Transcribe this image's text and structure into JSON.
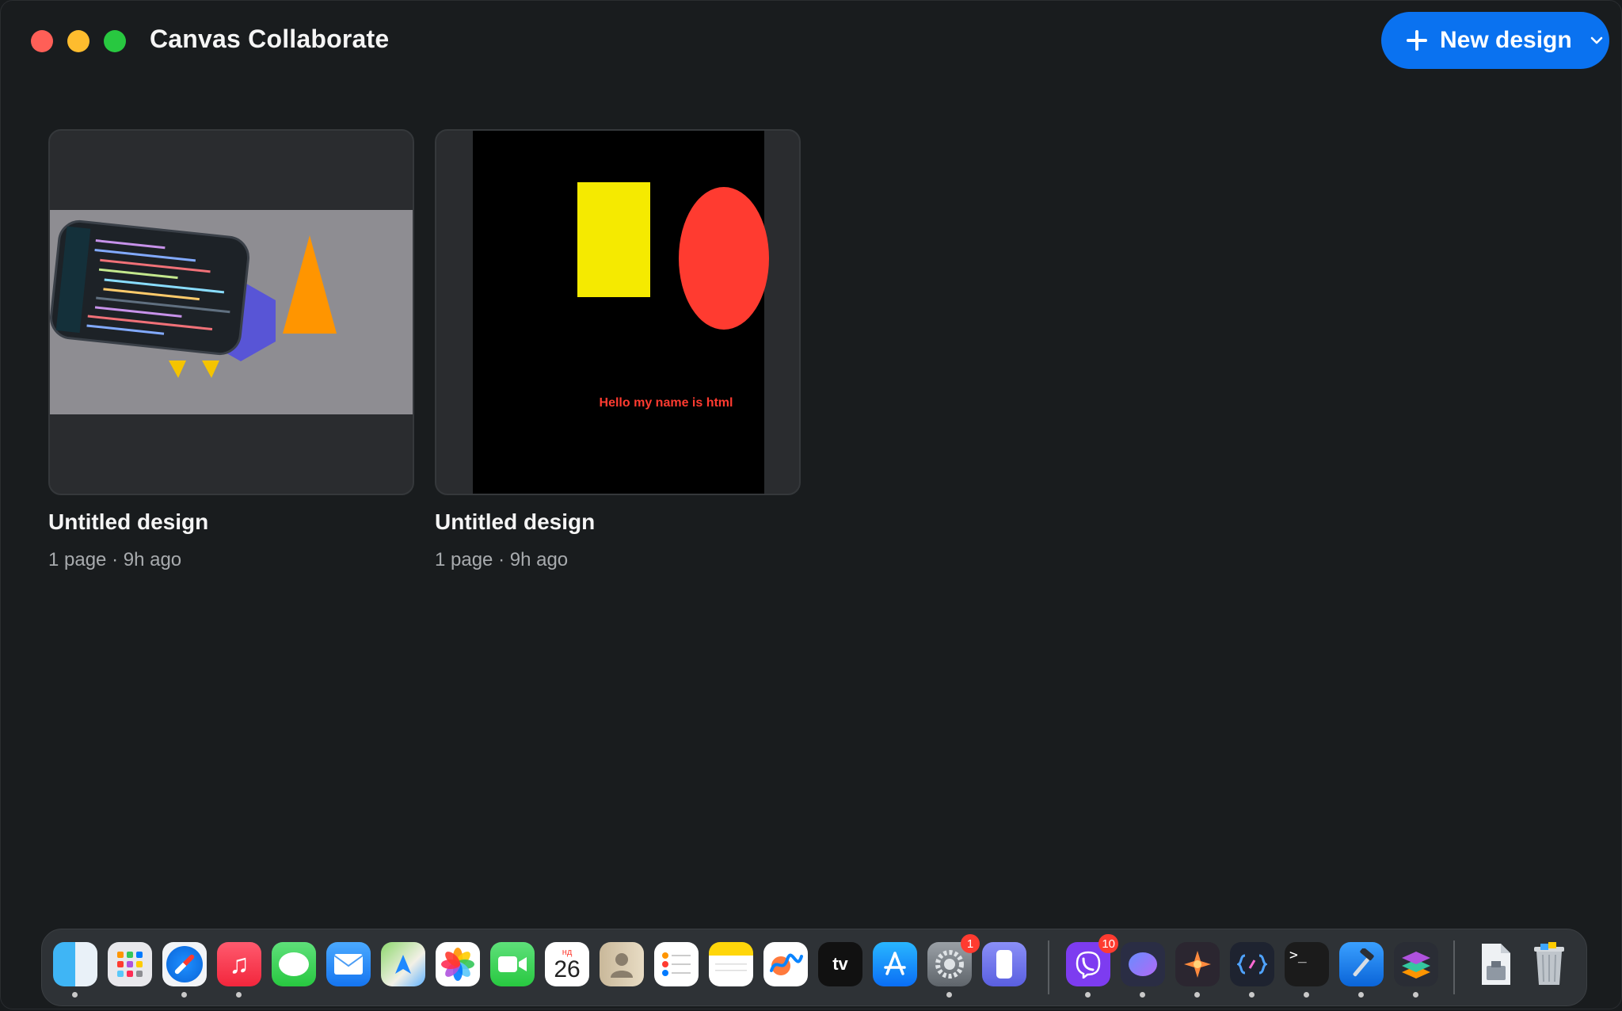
{
  "window": {
    "title": "Canvas Collaborate"
  },
  "toolbar": {
    "new_design_label": "New design"
  },
  "designs": [
    {
      "title": "Untitled design",
      "meta": "1 page · 9h ago"
    },
    {
      "title": "Untitled design",
      "meta": "1 page · 9h ago",
      "canvas_text": "Hello my name is html"
    }
  ],
  "dock": {
    "items": [
      {
        "icon": "finder-icon",
        "running": true
      },
      {
        "icon": "launchpad-icon",
        "running": false
      },
      {
        "icon": "safari-icon",
        "running": true
      },
      {
        "icon": "music-icon",
        "running": true
      },
      {
        "icon": "messages-icon",
        "running": false
      },
      {
        "icon": "mail-icon",
        "running": false
      },
      {
        "icon": "maps-icon",
        "running": false
      },
      {
        "icon": "photos-icon",
        "running": false
      },
      {
        "icon": "facetime-icon",
        "running": false
      },
      {
        "icon": "calendar-icon",
        "running": false,
        "month": "нд",
        "day": "26"
      },
      {
        "icon": "contacts-icon",
        "running": false
      },
      {
        "icon": "reminders-icon",
        "running": false
      },
      {
        "icon": "notes-icon",
        "running": false
      },
      {
        "icon": "freeform-icon",
        "running": false
      },
      {
        "icon": "apple-tv-icon",
        "running": false,
        "label": "tv"
      },
      {
        "icon": "app-store-icon",
        "running": false
      },
      {
        "icon": "system-settings-icon",
        "running": true,
        "badge": "1"
      },
      {
        "icon": "iphone-mirroring-icon",
        "running": false
      },
      {
        "icon": "viber-icon",
        "running": true,
        "badge": "10"
      },
      {
        "icon": "copilot-icon",
        "running": true
      },
      {
        "icon": "ai-app-icon",
        "running": true
      },
      {
        "icon": "code-editor-icon",
        "running": true
      },
      {
        "icon": "terminal-icon",
        "running": true,
        "label": ">_"
      },
      {
        "icon": "xcode-icon",
        "running": true
      },
      {
        "icon": "canvas-collaborate-icon",
        "running": true
      },
      {
        "icon": "archive-utility-icon",
        "running": false
      },
      {
        "icon": "trash-icon",
        "running": false
      }
    ]
  }
}
